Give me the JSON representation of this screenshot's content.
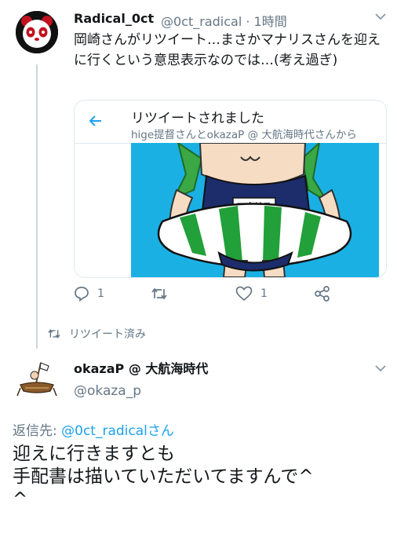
{
  "tweet1": {
    "display_name": "Radical_0ct",
    "handle_time": "@0ct_radical · 1時間",
    "text": "岡崎さんがリツイート…まさかマナリスさんを迎えに行くという意思表示なのでは…(考え過ぎ)",
    "quote_card": {
      "title": "リツイートされました",
      "subtitle": "hige提督さんとokazaP @ 大航海時代さんから",
      "badge_text": "マナリス"
    },
    "actions": {
      "reply_count": "1",
      "retweet_count": "",
      "like_count": "1"
    }
  },
  "retweeted_label": "リツイート済み",
  "tweet2": {
    "display_name": "okazaP @ 大航海時代",
    "handle": "@okaza_p",
    "reply_prefix": "返信先: ",
    "reply_target": "@0ct_radicalさん",
    "text_line1": "迎えに行きますとも",
    "text_line2": "手配書は描いていただいてますんで^",
    "text_line3": "^"
  },
  "colors": {
    "accent": "#1da1f2",
    "muted": "#657786",
    "divider": "#e1e8ed",
    "image_bg": "#1ab0e4"
  },
  "icons": [
    "chevron-down-icon",
    "back-arrow-icon",
    "reply-icon",
    "retweet-icon",
    "like-icon",
    "share-icon"
  ]
}
